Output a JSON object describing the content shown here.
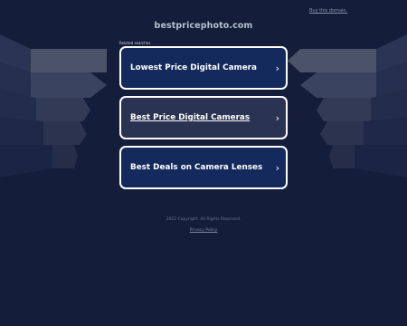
{
  "header": {
    "buy_link": "Buy this domain.",
    "domain": "bestpricephoto.com"
  },
  "related": {
    "label": "Related searches",
    "items": [
      {
        "label": "Lowest Price Digital Camera"
      },
      {
        "label": "Best Price Digital Cameras"
      },
      {
        "label": "Best Deals on Camera Lenses"
      }
    ]
  },
  "footer": {
    "copyright": "2022 Copyright. All Rights Reserved.",
    "privacy": "Privacy Policy"
  },
  "colors": {
    "background": "#141d39",
    "button_fill": "#14295c",
    "button_hover_fill": "#2a3352",
    "button_border": "#ffffff"
  },
  "icons": {
    "chevron": "chevron-right-icon"
  }
}
